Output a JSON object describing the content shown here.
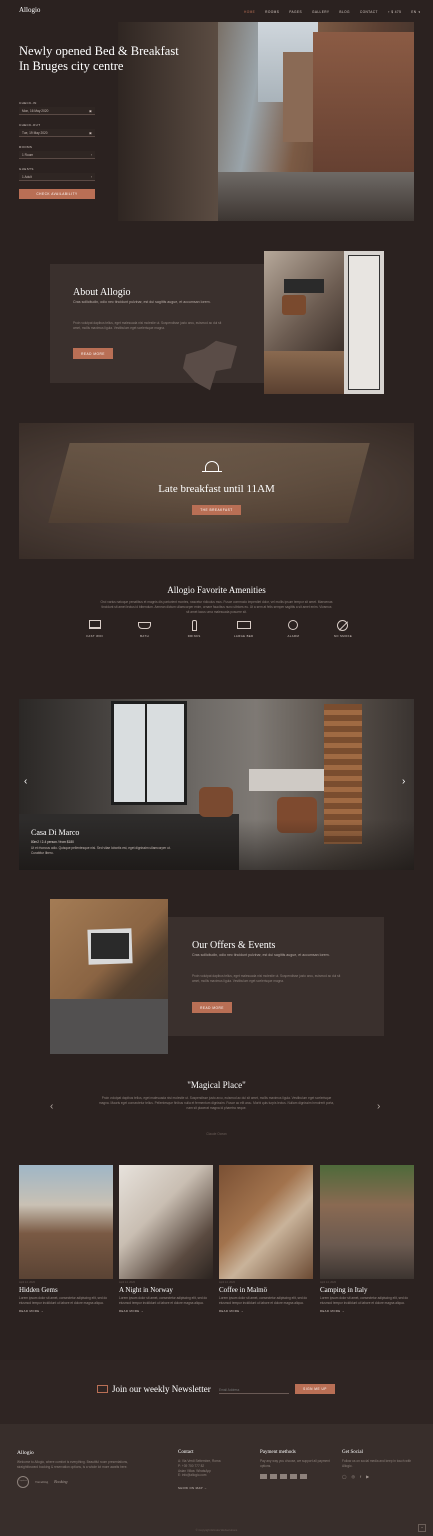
{
  "header": {
    "logo": "Allogio",
    "nav": [
      "Home",
      "Rooms",
      "Pages",
      "Gallery",
      "Blog",
      "Contact"
    ],
    "cart": "$ 475",
    "lang": "EN"
  },
  "hero": {
    "title_line1": "Newly opened Bed & Breakfast",
    "title_line2": "In Bruges city centre"
  },
  "booking": {
    "checkin_label": "Check-in",
    "checkin_value": "Mon, 16 May 2020",
    "checkout_label": "Check-out",
    "checkout_value": "Tue, 19 May 2020",
    "rooms_label": "Rooms",
    "rooms_value": "1 Room",
    "guests_label": "Guests",
    "guests_value": "1 Adult",
    "button": "Check availability"
  },
  "about": {
    "title": "About Allogio",
    "lead": "Cras sollicitudin, odio nec tincidunt pulvinar, est dui sagittis augue, et accumsan lorem.",
    "body": "Proin volutpat dapibus tellus, eget malesuada nisi molestie ut. Suspendisse justo arcu, euismod ac dui sit amet, mollis maximus ligula. Vestibulum eget scelerisque magna.",
    "button": "Read more"
  },
  "breakfast": {
    "title": "Late breakfast until 11AM",
    "button": "The breakfast"
  },
  "amenities": {
    "title": "Allogio Favorite Amenities",
    "text": "Orci varius natoque penatibus et magnis dis parturient montes, nascetur ridiculus mus. Fusce commodo imperdiet dolor, vel mollis ipsum tempor sit amet. Maecenas tincidunt sit amet lectus id bibendum. Aenean dictum ullamcorper enim, ornare faucibus nunc ultrices eu. Ut a sem at felis semper sagittis a sit amet enim. Vivamus sit amet lacus urna malesuada posuere sit.",
    "items": [
      {
        "label": "Fast WiFi",
        "icon": "laptop-icon"
      },
      {
        "label": "Bath",
        "icon": "bathtub-icon"
      },
      {
        "label": "Drinks",
        "icon": "bottle-icon"
      },
      {
        "label": "Large bed",
        "icon": "bed-icon"
      },
      {
        "label": "Alarm",
        "icon": "alarm-clock-icon"
      },
      {
        "label": "No smoke",
        "icon": "no-smoking-icon"
      }
    ]
  },
  "room": {
    "title": "Casa Di Marco",
    "meta": "80m2 / 2-4 person / from $180",
    "desc": "Ut et rhoncus odio. Quisque pellentesque nisi. Sed vitae lobortis est, eget dignissim ullamcorper ut. Curabitur libero."
  },
  "offers": {
    "title": "Our Offers & Events",
    "lead": "Cras sollicitudin, odio nec tincidunt pulvinar, est dui sagittis augue, et accumsan lorem.",
    "body": "Proin volutpat dapibus tellus, eget malesuada nisi molestie ut. Suspendisse justo arcu, euismod ac dui sit amet, mollis maximus ligula. Vestibulum eget scelerisque magna.",
    "button": "Read more"
  },
  "testimonial": {
    "title": "\"Magical Place\"",
    "text": "Proin volutpat dapibus tellus, eget malesuada nisi molestie ut. Suspendisse justo arcu, euismod ac dui sit amet, mollis maximus ligula. Vestibulum eget scelerisque magna. Mauris eget consectetur tellus. Pellentesque finibus nulla et fermentum dignissim. Fusce ac elit arcu. Morbi quis turpis lectus. Nullam dignissim hendrerit porta, nam sit placerat magna id pharetra neque.",
    "author": "Claude Ocean"
  },
  "blog": [
    {
      "date": "April 14, 2020",
      "title": "Hidden Gems",
      "excerpt": "Lorem ipsum dolor sit amet, consectetur adipiscing elit, sed do eiusmod tempor incididunt ut labore et dolore magna aliqua.",
      "more": "Read more"
    },
    {
      "date": "April 14, 2020",
      "title": "A Night in Norway",
      "excerpt": "Lorem ipsum dolor sit amet, consectetur adipiscing elit, sed do eiusmod tempor incididunt ut labore et dolore magna aliqua.",
      "more": "Read more"
    },
    {
      "date": "April 14, 2020",
      "title": "Coffee in Malmö",
      "excerpt": "Lorem ipsum dolor sit amet, consectetur adipiscing elit, sed do eiusmod tempor incididunt ut labore et dolore magna aliqua.",
      "more": "Read more"
    },
    {
      "date": "April 14, 2020",
      "title": "Camping in Italy",
      "excerpt": "Lorem ipsum dolor sit amet, consectetur adipiscing elit, sed do eiusmod tempor incididunt ut labore et dolore magna aliqua.",
      "more": "Read more"
    }
  ],
  "newsletter": {
    "title": "Join our weekly Newsletter",
    "placeholder": "Email Address",
    "button": "Sign me up"
  },
  "footer": {
    "about_title": "Allogio",
    "about_text": "Welcome to Allogio, where comfort is everything. Beautiful room presentations, straightforward booking & reservation options, is a whole lot more awaits here.",
    "contact_title": "Contact",
    "contact_lines": [
      "A: Via Verdi Settembre, Roma",
      "P: +39 700 777 82",
      "Asian Villas: WhatsApp",
      "E: info@allogio.com"
    ],
    "map_link": "Show on map",
    "payment_title": "Payment methods",
    "payment_text": "Pay any way you choose, we support all payment options.",
    "social_title": "Get Social",
    "social_text": "Follow us on social media and keep in touch with Allogio.",
    "badges": [
      "Tripadvisor",
      "Travelling",
      "Booking"
    ],
    "copyright": "© Copyright Elmala Websolutions"
  }
}
